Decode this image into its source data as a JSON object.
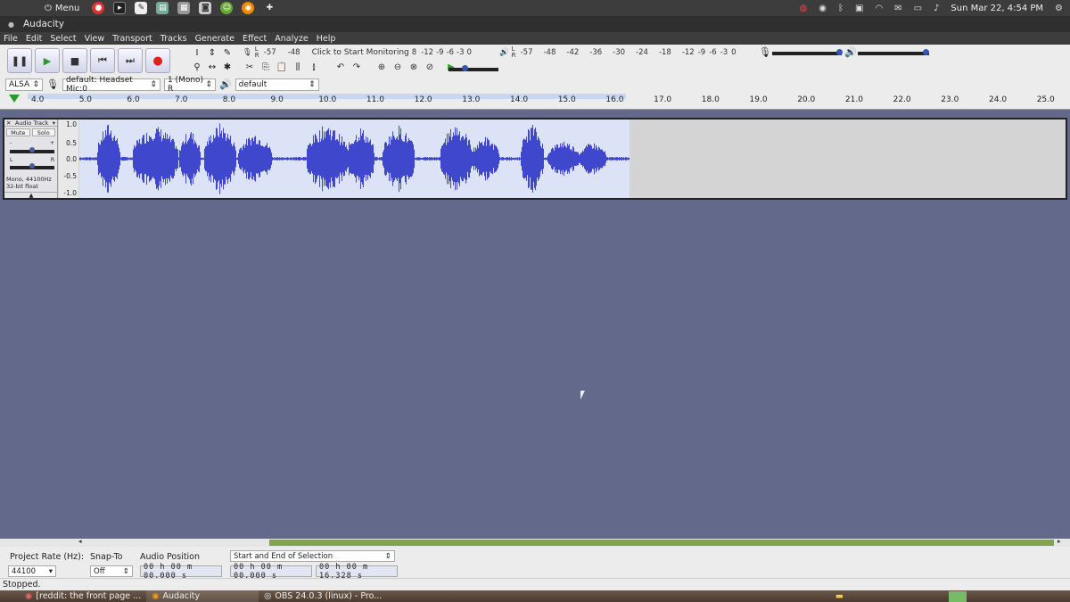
{
  "system_panel": {
    "menu_label": "Menu",
    "clock": "Sun Mar 22,  4:54 PM"
  },
  "window": {
    "title": "Audacity"
  },
  "menubar": {
    "items": [
      "File",
      "Edit",
      "Select",
      "View",
      "Transport",
      "Tracks",
      "Generate",
      "Effect",
      "Analyze",
      "Help"
    ]
  },
  "meters": {
    "record_lr": "L\nR",
    "record_scale": [
      "-57",
      "-48",
      "Click to Start Monitoring",
      "8",
      "-12",
      "-9",
      "-6",
      "-3",
      "0"
    ],
    "playback_scale": [
      "-57",
      "-48",
      "-42",
      "-36",
      "-30",
      "-24",
      "-18",
      "-12",
      "-9",
      "-6",
      "-3",
      "0"
    ]
  },
  "device_toolbar": {
    "host": "ALSA",
    "recording_device": "default: Headset Mic:0",
    "channels": "1 (Mono) R",
    "playback_device": "default"
  },
  "ruler": {
    "ticks": [
      "4.0",
      "5.0",
      "6.0",
      "7.0",
      "8.0",
      "9.0",
      "10.0",
      "11.0",
      "12.0",
      "13.0",
      "14.0",
      "15.0",
      "16.0",
      "17.0",
      "18.0",
      "19.0",
      "20.0",
      "21.0",
      "22.0",
      "23.0",
      "24.0",
      "25.0"
    ]
  },
  "track": {
    "name": "Audio Track",
    "mute": "Mute",
    "solo": "Solo",
    "gain_minus": "-",
    "gain_plus": "+",
    "pan_l": "L",
    "pan_r": "R",
    "info_line1": "Mono, 44100Hz",
    "info_line2": "32-bit float",
    "scale": [
      "1.0",
      "0.5",
      "0.0",
      "-0.5",
      "-1.0"
    ]
  },
  "selection_bar": {
    "project_rate_label": "Project Rate (Hz):",
    "project_rate_value": "44100",
    "snap_to_label": "Snap-To",
    "snap_to_value": "Off",
    "audio_position_label": "Audio Position",
    "audio_position_value": "00 h 00 m 00.000 s",
    "selection_mode": "Start and End of Selection",
    "selection_start": "00 h 00 m 00.000 s",
    "selection_end": "00 h 00 m 16.328 s"
  },
  "status": {
    "text": "Stopped."
  },
  "taskbar": {
    "items": [
      "[reddit: the front page ...",
      "Audacity",
      "OBS 24.0.3 (linux) - Pro..."
    ]
  },
  "colors": {
    "waveform": "#3f48cc",
    "waveform_bg": "#dde3f6",
    "background": "#63698a",
    "scroll_thumb": "#82a34e"
  }
}
